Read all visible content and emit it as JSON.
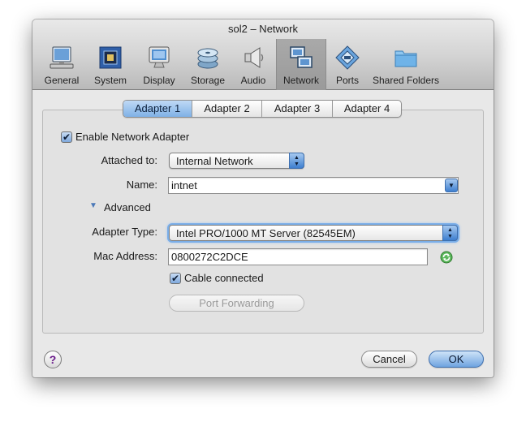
{
  "window": {
    "title": "sol2 – Network"
  },
  "toolbar": {
    "items": [
      {
        "label": "General",
        "icon": "monitor-icon"
      },
      {
        "label": "System",
        "icon": "chip-icon"
      },
      {
        "label": "Display",
        "icon": "display-icon"
      },
      {
        "label": "Storage",
        "icon": "disk-stack-icon"
      },
      {
        "label": "Audio",
        "icon": "speaker-icon"
      },
      {
        "label": "Network",
        "icon": "network-icon",
        "selected": true
      },
      {
        "label": "Ports",
        "icon": "port-icon"
      },
      {
        "label": "Shared Folders",
        "icon": "folder-icon"
      }
    ]
  },
  "adapter_tabs": [
    {
      "label": "Adapter 1",
      "selected": true
    },
    {
      "label": "Adapter 2"
    },
    {
      "label": "Adapter 3"
    },
    {
      "label": "Adapter 4"
    }
  ],
  "form": {
    "enable_label": "Enable Network Adapter",
    "enable_checked": true,
    "attached_label": "Attached to:",
    "attached_value": "Internal Network",
    "name_label": "Name:",
    "name_value": "intnet",
    "advanced_label": "Advanced",
    "adapter_type_label": "Adapter Type:",
    "adapter_type_value": "Intel PRO/1000 MT Server (82545EM)",
    "mac_label": "Mac Address:",
    "mac_value": "0800272C2DCE",
    "cable_label": "Cable connected",
    "cable_checked": true,
    "port_forwarding_label": "Port Forwarding"
  },
  "buttons": {
    "help": "?",
    "cancel": "Cancel",
    "ok": "OK"
  },
  "colors": {
    "accent": "#3e7fcf",
    "selected_toolbar": "#a3a3a3",
    "help_glyph": "#6a1a8a"
  }
}
